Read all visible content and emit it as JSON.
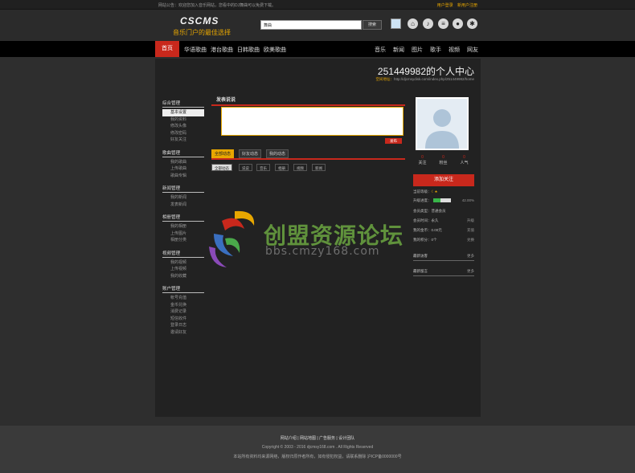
{
  "topbar": {
    "notice": "网站公告：欢迎您加入音乐网站，您看中的DJ舞曲可以免费下载。",
    "login": "用户登录",
    "register": "新用户注册"
  },
  "header": {
    "logo": "CSCMS",
    "slogan": "音乐门户的最佳选择",
    "search_value": "舞曲",
    "search_button": "搜索",
    "icons": [
      "home-icon",
      "music-icon",
      "playlist-icon",
      "user-icon",
      "settings-icon"
    ]
  },
  "nav": {
    "items": [
      "首页",
      "华语歌曲",
      "港台歌曲",
      "日韩歌曲",
      "欧美歌曲"
    ],
    "right_items": [
      "音乐",
      "新闻",
      "图片",
      "歌手",
      "视频",
      "网友"
    ]
  },
  "profile": {
    "title": "251449982的个人中心",
    "url_label": "空间地址：",
    "url": "http://djcmsydisk.com/index.php/251449982/home"
  },
  "sidebar": {
    "sections": [
      {
        "title": "综合管理",
        "items": [
          "基本设置",
          "我的资料",
          "修改头像",
          "修改密码",
          "好友关注"
        ]
      },
      {
        "title": "歌曲管理",
        "items": [
          "我的歌曲",
          "上传歌曲",
          "歌曲专辑"
        ]
      },
      {
        "title": "新闻管理",
        "items": [
          "我的新闻",
          "发表新闻"
        ]
      },
      {
        "title": "相册管理",
        "items": [
          "我的相册",
          "上传图片",
          "相册分类"
        ]
      },
      {
        "title": "视频管理",
        "items": [
          "我的视频",
          "上传视频",
          "我的收藏"
        ]
      },
      {
        "title": "账户管理",
        "items": [
          "帐号充值",
          "金币兑换",
          "消费记录",
          "短信收件",
          "登录日志",
          "邀请好友"
        ]
      }
    ]
  },
  "content": {
    "title": "发表说说",
    "publish": "发布",
    "tabs": [
      "全部动态",
      "好友动态",
      "我的动态"
    ],
    "filters": [
      "全部动态",
      "说说",
      "音乐",
      "相册",
      "视频",
      "新闻"
    ]
  },
  "right": {
    "stats": [
      {
        "num": "0",
        "label": "关注"
      },
      {
        "num": "0",
        "label": "粉丝"
      },
      {
        "num": "0",
        "label": "人气"
      }
    ],
    "follow_button": "添加关注",
    "level_label": "当前等级：",
    "level_icon": "moon-star-icon",
    "progress_label": "升级进度：",
    "progress_fraction": 0.42,
    "progress_text": "42.00%",
    "account_type": "会员类型：普通会员",
    "row1_left": "会员时间：永久",
    "row1_right": "升级",
    "row2_left": "我的金币：0.00元",
    "row2_right": "充值",
    "row3_left": "我的积分：0个",
    "row3_right": "兑换",
    "line1_left": "最新访客",
    "line1_right": "更多",
    "line2_left": "最新留言",
    "line2_right": "更多"
  },
  "watermark": {
    "text": "创盟资源论坛",
    "url": "bbs.cmzy168.com"
  },
  "footer": {
    "links": "网站介绍 | 网站地图 | 广告服务 | 设计团队",
    "copyright": "Copyright © 2003 - 2016 djcmsy168.com . All Rights Reserved",
    "disclaimer": "本站所有资料均来源网络，版权归原作者所有，如有侵犯权益，请联系删除  沪ICP备0000000号"
  },
  "colors": {
    "accent_red": "#c8281c",
    "accent_orange": "#e8a700",
    "progress_green": "#39b54a"
  }
}
